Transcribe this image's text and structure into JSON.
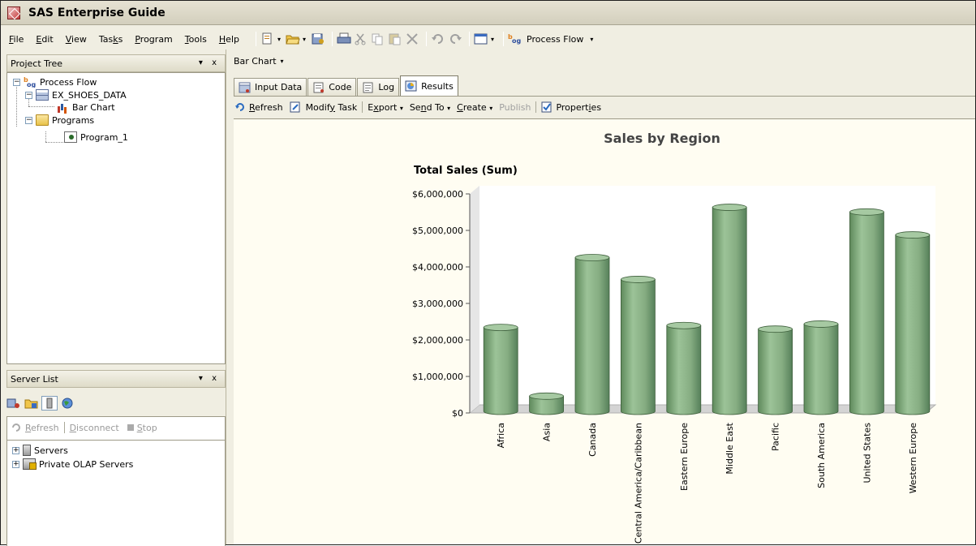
{
  "app": {
    "title": "SAS Enterprise Guide"
  },
  "menu": [
    {
      "pre": "",
      "u": "F",
      "post": "ile"
    },
    {
      "pre": "",
      "u": "E",
      "post": "dit"
    },
    {
      "pre": "",
      "u": "V",
      "post": "iew"
    },
    {
      "pre": "Tas",
      "u": "k",
      "post": "s"
    },
    {
      "pre": "",
      "u": "P",
      "post": "rogram"
    },
    {
      "pre": "",
      "u": "T",
      "post": "ools"
    },
    {
      "pre": "",
      "u": "H",
      "post": "elp"
    }
  ],
  "toolbar": {
    "process_flow_label": "Process Flow",
    "process_flow_icon": "process-flow-icon"
  },
  "project_tree": {
    "title": "Project Tree",
    "controls": "▾ x",
    "nodes": [
      {
        "label": "Process Flow",
        "icon": "process-flow-icon",
        "expander": "−"
      },
      {
        "label": "EX_SHOES_DATA",
        "icon": "data-table-icon",
        "expander": "−"
      },
      {
        "label": "Bar Chart",
        "icon": "bar-chart-icon"
      },
      {
        "label": "Programs",
        "icon": "folder-icon",
        "expander": "−"
      },
      {
        "label": "Program_1",
        "icon": "program-icon"
      }
    ]
  },
  "server_list": {
    "title": "Server List",
    "controls": "▾ x",
    "toolbar": {
      "refresh": {
        "u": "R",
        "post": "efresh"
      },
      "disconnect": {
        "u": "D",
        "post": "isconnect"
      },
      "stop": {
        "u": "S",
        "post": "top"
      }
    },
    "nodes": [
      {
        "label": "Servers",
        "icon": "server-icon",
        "expander": "+"
      },
      {
        "label": "Private OLAP Servers",
        "icon": "olap-server-icon",
        "expander": "+"
      }
    ]
  },
  "document": {
    "title": "Bar Chart"
  },
  "tabs": [
    {
      "label": "Input Data",
      "icon": "input-data-icon",
      "active": false
    },
    {
      "label": "Code",
      "icon": "code-icon",
      "active": false
    },
    {
      "label": "Log",
      "icon": "log-icon",
      "active": false
    },
    {
      "label": "Results",
      "icon": "results-icon",
      "active": true
    }
  ],
  "results_toolbar": {
    "refresh": {
      "u": "R",
      "post": "efresh"
    },
    "modify_task": {
      "pre": "Modif",
      "u": "y",
      "post": " Task"
    },
    "export": {
      "pre": "E",
      "u": "x",
      "post": "port"
    },
    "send_to": {
      "pre": "Se",
      "u": "n",
      "post": "d To"
    },
    "create": {
      "pre": "",
      "u": "C",
      "post": "reate"
    },
    "publish": "Publish",
    "properties": {
      "pre": "Propert",
      "u": "i",
      "post": "es"
    }
  },
  "chart_data": {
    "type": "bar",
    "title": "Sales by Region",
    "ylabel": "Total Sales (Sum)",
    "xlabel": "",
    "categories": [
      "Africa",
      "Asia",
      "Canada",
      "Central America/Caribbean",
      "Eastern Europe",
      "Middle East",
      "Pacific",
      "South America",
      "United States",
      "Western Europe"
    ],
    "values": [
      2342000,
      460000,
      4255000,
      3657000,
      2395000,
      5632000,
      2296000,
      2435000,
      5504000,
      4876000
    ],
    "yticks": [
      "$0",
      "$1,000,000",
      "$2,000,000",
      "$3,000,000",
      "$4,000,000",
      "$5,000,000",
      "$6,000,000"
    ],
    "ylim": [
      0,
      6000000
    ],
    "bar_color": "#8fb08a",
    "grid": false,
    "style": "3d-cylinder"
  }
}
